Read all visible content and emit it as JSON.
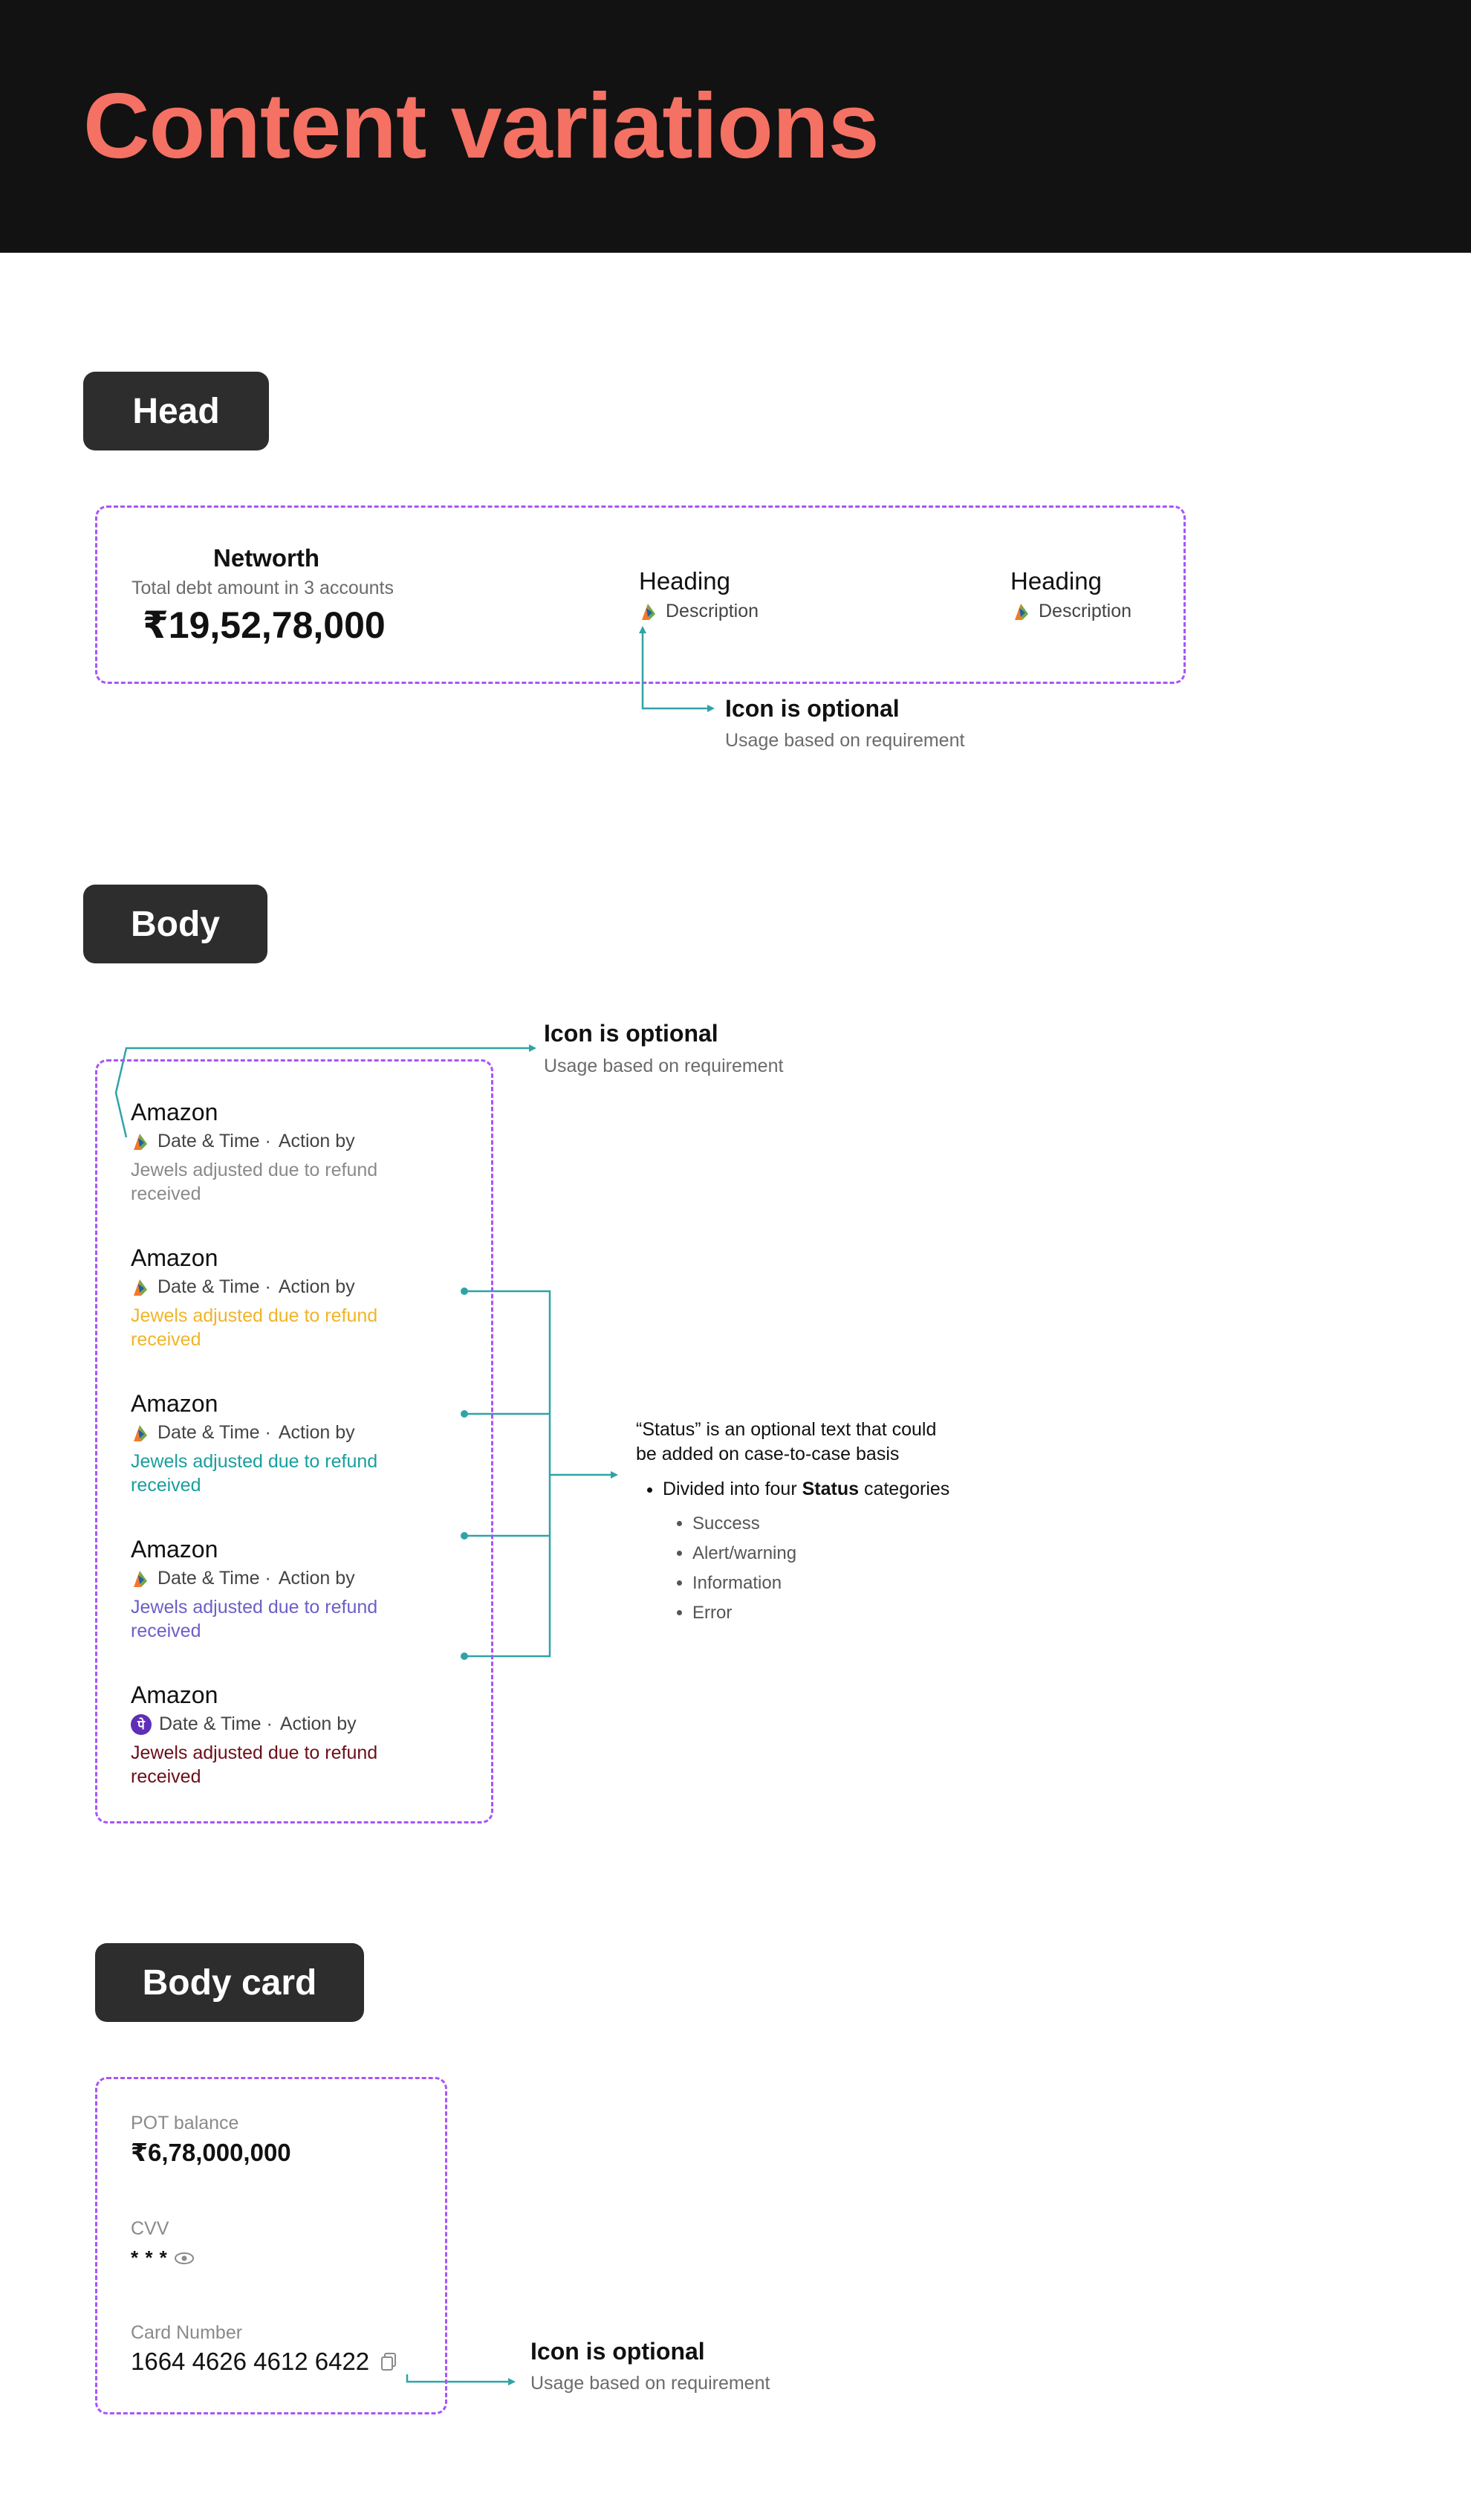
{
  "page_title": "Content variations",
  "colors": {
    "accent": "#f47163",
    "dash": "#a855f7",
    "connector": "#2fa3a8",
    "status_warning": "#f0b429",
    "status_success": "#1a9e9e",
    "status_info": "#6b5fc7",
    "status_error": "#6b0f1a"
  },
  "sections": {
    "head": {
      "label": "Head"
    },
    "body": {
      "label": "Body"
    },
    "body_card": {
      "label": "Body card"
    }
  },
  "head_demo": {
    "networth": {
      "title": "Networth",
      "subtitle": "Total debt amount in 3 accounts",
      "amount": "₹19,52,78,000"
    },
    "heading_a": {
      "title": "Heading",
      "description": "Description",
      "icon": "flag-icon"
    },
    "heading_b": {
      "title": "Heading",
      "description": "Description",
      "icon": "flag-icon"
    },
    "note": {
      "title": "Icon is optional",
      "subtitle": "Usage based on requirement"
    }
  },
  "body_demo": {
    "note": {
      "title": "Icon is optional",
      "subtitle": "Usage based on requirement"
    },
    "items": [
      {
        "title": "Amazon",
        "meta_date": "Date & Time ·",
        "meta_action": "Action by",
        "desc": "Jewels adjusted due to refund received",
        "status_color": "#8a8a8a",
        "icon": "flag-icon"
      },
      {
        "title": "Amazon",
        "meta_date": "Date & Time ·",
        "meta_action": "Action by",
        "desc": "Jewels adjusted due to refund received",
        "status_color": "#f0b429",
        "icon": "flag-icon"
      },
      {
        "title": "Amazon",
        "meta_date": "Date & Time ·",
        "meta_action": "Action by",
        "desc": "Jewels adjusted due to refund received",
        "status_color": "#1a9e9e",
        "icon": "flag-icon"
      },
      {
        "title": "Amazon",
        "meta_date": "Date & Time ·",
        "meta_action": "Action by",
        "desc": "Jewels adjusted due to refund received",
        "status_color": "#6b5fc7",
        "icon": "flag-icon"
      },
      {
        "title": "Amazon",
        "meta_date": "Date & Time ·",
        "meta_action": "Action by",
        "desc": "Jewels adjusted due to refund received",
        "status_color": "#6b0f1a",
        "icon": "phonepe-icon",
        "icon_glyph": "पे"
      }
    ],
    "status_note": {
      "line1": "“Status” is an optional text that could",
      "line2": "be added on case-to-case basis",
      "bullet_prefix": "Divided into four ",
      "bullet_bold": "Status",
      "bullet_suffix": " categories",
      "categories": [
        "Success",
        "Alert/warning",
        "Information",
        "Error"
      ]
    }
  },
  "card_demo": {
    "pot": {
      "label": "POT balance",
      "value": "₹6,78,000,000"
    },
    "cvv": {
      "label": "CVV",
      "value": "* * *",
      "icon": "eye-icon"
    },
    "card": {
      "label": "Card Number",
      "value": "1664 4626 4612 6422",
      "icon": "copy-icon"
    },
    "note": {
      "title": "Icon is optional",
      "subtitle": "Usage based on requirement"
    }
  }
}
